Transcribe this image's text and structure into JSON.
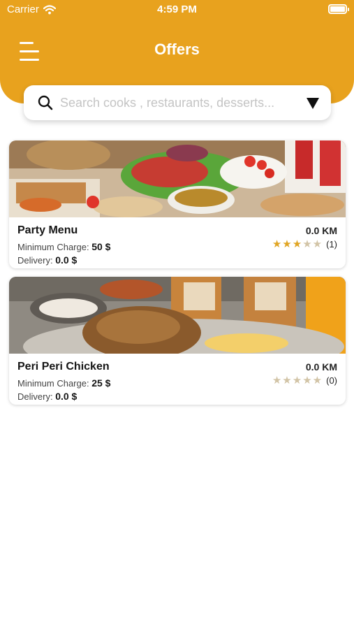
{
  "status_bar": {
    "carrier": "Carrier",
    "time": "4:59 PM"
  },
  "header": {
    "title": "Offers"
  },
  "search": {
    "placeholder": "Search cooks , restaurants, desserts..."
  },
  "offers": [
    {
      "name": "Party Menu",
      "min_charge_label": "Minimum Charge:",
      "min_charge": "50 $",
      "delivery_label": "Delivery:",
      "delivery": "0.0 $",
      "distance": "0.0 KM",
      "rating": 3,
      "rating_count": "(1)"
    },
    {
      "name": "Peri Peri Chicken",
      "min_charge_label": "Minimum Charge:",
      "min_charge": "25 $",
      "delivery_label": "Delivery:",
      "delivery": "0.0 $",
      "distance": "0.0 KM",
      "rating": 0,
      "rating_count": "(0)"
    }
  ],
  "colors": {
    "accent": "#e8a21e",
    "star_on": "#e0a523",
    "star_off": "#d2c4a6"
  }
}
